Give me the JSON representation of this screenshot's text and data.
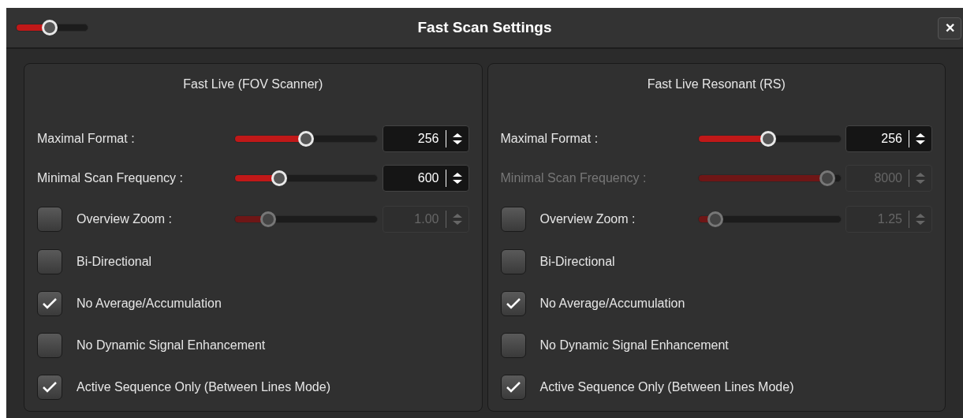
{
  "window": {
    "title": "Fast Scan Settings",
    "close": "✕",
    "title_slider": {
      "level": 0.45
    }
  },
  "panels": [
    {
      "title": "Fast Live (FOV Scanner)",
      "rows": [
        {
          "kind": "slider",
          "label": "Maximal Format :",
          "value": "256",
          "level": 0.5,
          "disabled": false
        },
        {
          "kind": "slider",
          "label": "Minimal Scan Frequency :",
          "value": "600",
          "level": 0.29,
          "disabled": false
        },
        {
          "kind": "checkbox_slider",
          "label": "Overview Zoom :",
          "checked": false,
          "value": "1.00",
          "level": 0.2,
          "disabled": true
        },
        {
          "kind": "checkbox",
          "label": "Bi-Directional",
          "checked": false
        },
        {
          "kind": "checkbox",
          "label": "No Average/Accumulation",
          "checked": true
        },
        {
          "kind": "checkbox",
          "label": "No Dynamic Signal Enhancement",
          "checked": false
        },
        {
          "kind": "checkbox",
          "label": "Active Sequence Only (Between Lines Mode)",
          "checked": true
        }
      ]
    },
    {
      "title": "Fast Live Resonant (RS)",
      "rows": [
        {
          "kind": "slider",
          "label": "Maximal Format :",
          "value": "256",
          "level": 0.49,
          "disabled": false
        },
        {
          "kind": "slider",
          "label": "Minimal Scan Frequency :",
          "value": "8000",
          "level": 0.96,
          "disabled": true
        },
        {
          "kind": "checkbox_slider",
          "label": "Overview Zoom :",
          "checked": false,
          "value": "1.25",
          "level": 0.07,
          "disabled": true
        },
        {
          "kind": "checkbox",
          "label": "Bi-Directional",
          "checked": false
        },
        {
          "kind": "checkbox",
          "label": "No Average/Accumulation",
          "checked": true
        },
        {
          "kind": "checkbox",
          "label": "No Dynamic Signal Enhancement",
          "checked": false
        },
        {
          "kind": "checkbox",
          "label": "Active Sequence Only (Between Lines Mode)",
          "checked": true
        }
      ]
    }
  ]
}
